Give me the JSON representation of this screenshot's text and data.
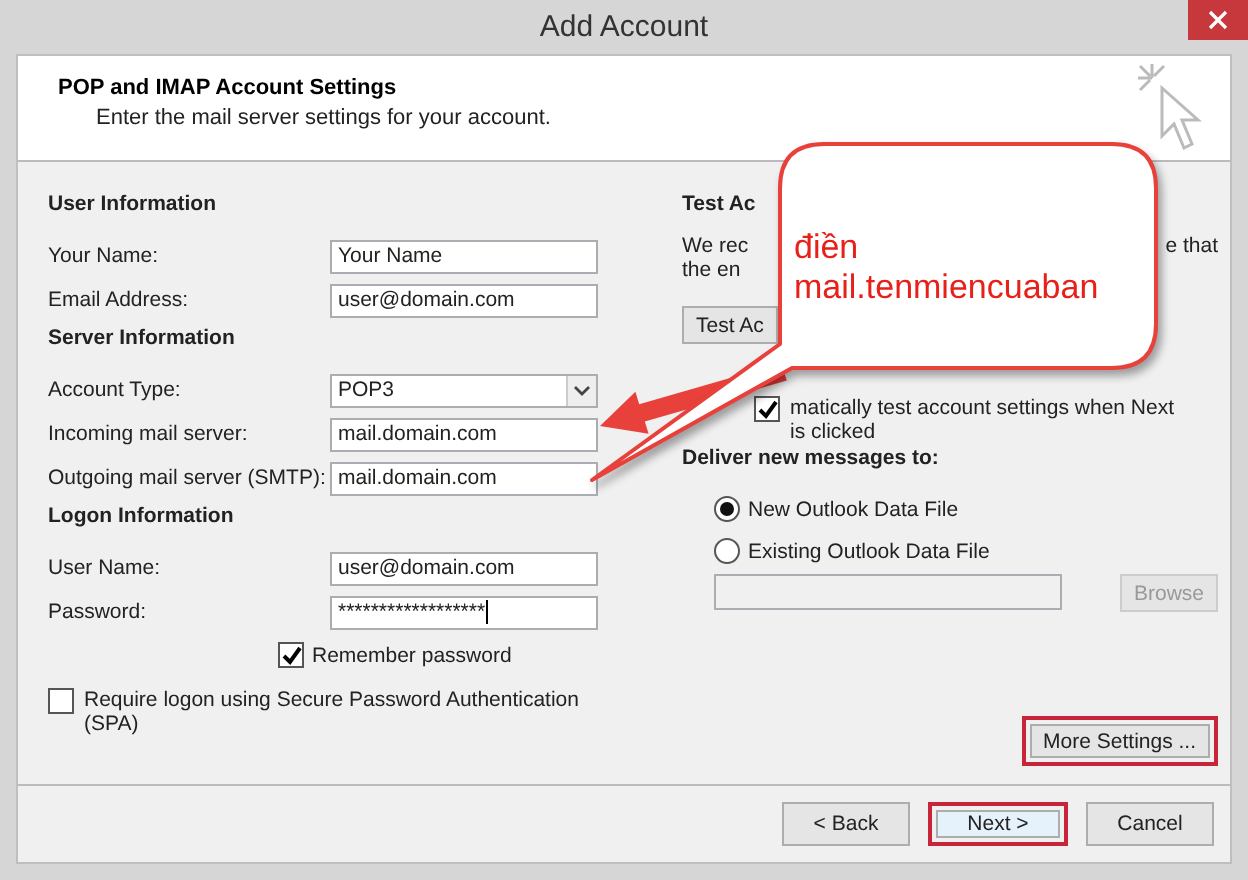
{
  "window": {
    "title": "Add Account"
  },
  "header": {
    "title": "POP and IMAP Account Settings",
    "subtitle": "Enter the mail server settings for your account."
  },
  "left_sections": [
    {
      "heading": "User Information",
      "fields": [
        {
          "kind": "text",
          "label": "Your Name:",
          "value": "Your Name"
        },
        {
          "kind": "text",
          "label": "Email Address:",
          "value": "user@domain.com"
        }
      ]
    },
    {
      "heading": "Server Information",
      "fields": [
        {
          "kind": "select",
          "label": "Account Type:",
          "value": "POP3"
        },
        {
          "kind": "text",
          "label": "Incoming mail server:",
          "value": "mail.domain.com"
        },
        {
          "kind": "text",
          "label": "Outgoing mail server (SMTP):",
          "value": "mail.domain.com"
        }
      ]
    },
    {
      "heading": "Logon Information",
      "fields": [
        {
          "kind": "text",
          "label": "User Name:",
          "value": "user@domain.com"
        },
        {
          "kind": "password",
          "label": "Password:",
          "value": "******************"
        }
      ]
    }
  ],
  "remember_password": {
    "label": "Remember password",
    "checked": true
  },
  "spa": {
    "label": "Require logon using Secure Password Authentication (SPA)",
    "checked": false
  },
  "test_settings": {
    "heading": "Test Ac",
    "text_left": [
      "We rec",
      "the en"
    ],
    "text_right": "e that",
    "button": "Test Ac",
    "auto_test": {
      "lines": [
        "matically test account settings when Next",
        "is clicked"
      ],
      "checked": true
    }
  },
  "deliver": {
    "heading": "Deliver new messages to:",
    "options": [
      {
        "label": "New Outlook Data File",
        "selected": true
      },
      {
        "label": "Existing Outlook Data File",
        "selected": false
      }
    ],
    "browse_button": {
      "label": "Browse",
      "disabled": true
    }
  },
  "more_settings": {
    "label": "More Settings ...",
    "highlighted": true
  },
  "footer_buttons": [
    {
      "label": "< Back",
      "highlighted": false,
      "default": false
    },
    {
      "label": "Next >",
      "highlighted": true,
      "default": true
    },
    {
      "label": "Cancel",
      "highlighted": false,
      "default": false
    }
  ],
  "callout": {
    "lines": [
      "điền",
      "mail.tenmiencuaban"
    ]
  }
}
